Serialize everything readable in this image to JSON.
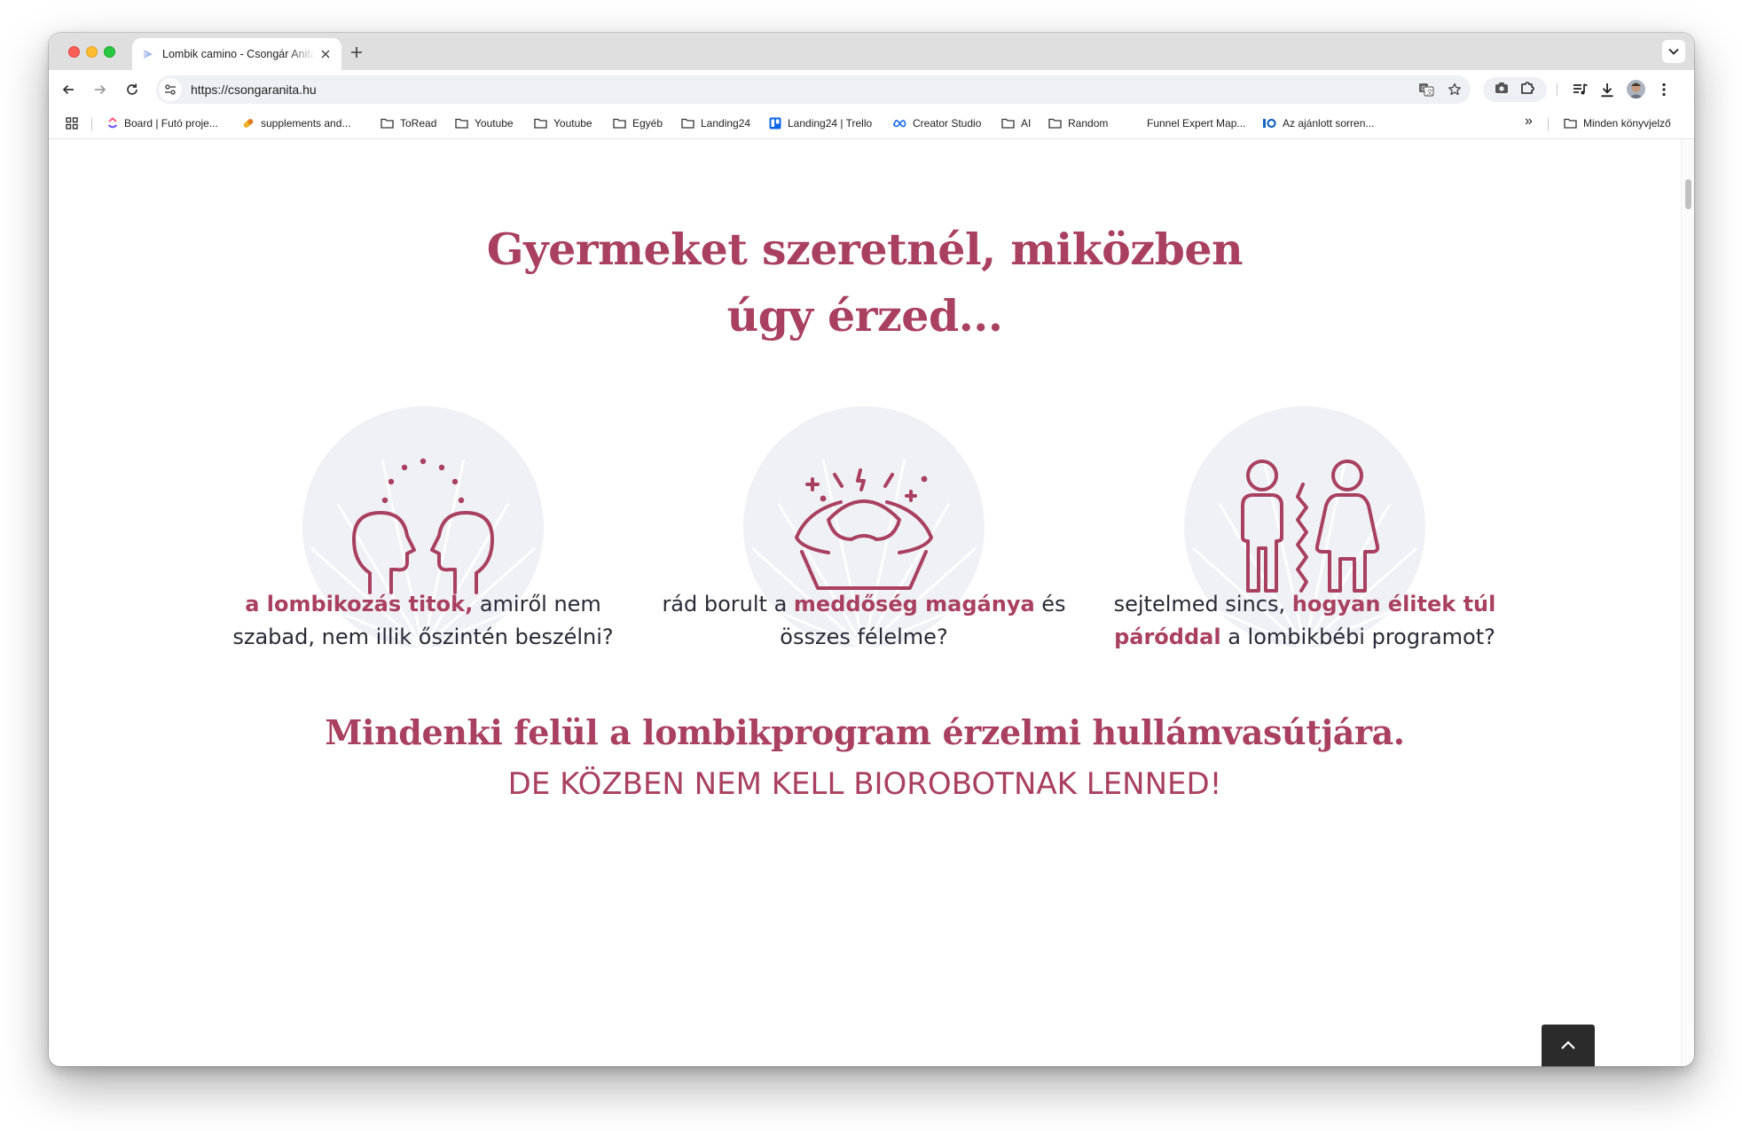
{
  "browser": {
    "tab_title": "Lombik camino - Csongár Anita",
    "url": "https://csongaranita.hu",
    "icons": {
      "back": "back-arrow-icon",
      "forward": "forward-arrow-icon",
      "reload": "reload-icon",
      "site_info": "site-info-icon",
      "translate": "translate-icon",
      "bookmark_star": "star-icon",
      "screenshot": "camera-icon",
      "extensions": "puzzle-icon",
      "reading_list": "media-controls-icon",
      "downloads": "download-icon",
      "menu": "kebab-menu-icon"
    }
  },
  "bookmarks": {
    "items": [
      {
        "label": "Board | Futó proje...",
        "icon": "clickup-icon"
      },
      {
        "label": "supplements and...",
        "icon": "pill-icon"
      },
      {
        "label": "ToRead",
        "icon": "folder-icon"
      },
      {
        "label": "Youtube",
        "icon": "folder-icon"
      },
      {
        "label": "Youtube",
        "icon": "folder-icon"
      },
      {
        "label": "Egyéb",
        "icon": "folder-icon"
      },
      {
        "label": "Landing24",
        "icon": "folder-icon"
      },
      {
        "label": "Landing24 | Trello",
        "icon": "trello-icon"
      },
      {
        "label": "Creator Studio",
        "icon": "meta-icon"
      },
      {
        "label": "AI",
        "icon": "folder-icon"
      },
      {
        "label": "Random",
        "icon": "folder-icon"
      },
      {
        "label": "Funnel Expert Map...",
        "icon": "blank-icon"
      },
      {
        "label": "Az ajánlott sorren...",
        "icon": "io-icon"
      }
    ],
    "overflow_label": "»",
    "all_bookmarks": "Minden könyvjelző"
  },
  "page": {
    "headline_line1": "Gyermeket szeretnél, miközben",
    "headline_line2": "úgy érzed...",
    "features": [
      {
        "icon": "two-heads-icon",
        "bold_lead": "a lombikozás titok,",
        "text_after": " amiről nem szabad, nem illik őszintén beszélni?"
      },
      {
        "icon": "stressed-person-icon",
        "text_before": "rád borult a ",
        "bold_mid": "meddőség magánya",
        "text_after": " és összes félelme?"
      },
      {
        "icon": "couple-split-icon",
        "text_before": "sejtelmed sincs, ",
        "bold_mid": "hogyan élitek túl páróddal",
        "text_after": " a lombikbébi programot?"
      }
    ],
    "subheadline": "Mindenki felül a lombikprogram érzelmi hullámvasútjára.",
    "tagline": "DE KÖZBEN NEM KELL BIOROBOTNAK LENNED!",
    "scroll_top_icon": "chevron-up-icon"
  },
  "colors": {
    "accent": "#a9405f",
    "circle_bg": "#eff1f6",
    "body_text": "#2a2a36"
  }
}
